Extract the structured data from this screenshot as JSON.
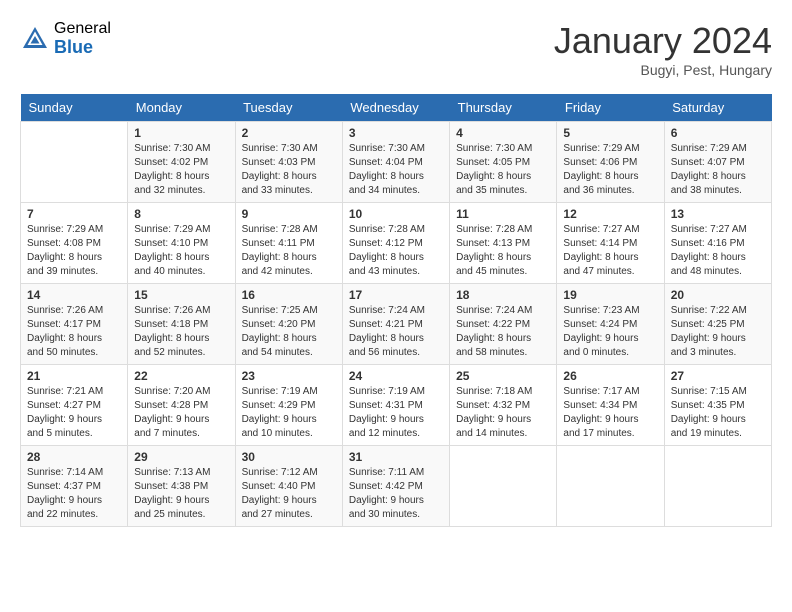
{
  "header": {
    "logo_general": "General",
    "logo_blue": "Blue",
    "month_title": "January 2024",
    "location": "Bugyi, Pest, Hungary"
  },
  "weekdays": [
    "Sunday",
    "Monday",
    "Tuesday",
    "Wednesday",
    "Thursday",
    "Friday",
    "Saturday"
  ],
  "weeks": [
    [
      {
        "day": "",
        "info": ""
      },
      {
        "day": "1",
        "info": "Sunrise: 7:30 AM\nSunset: 4:02 PM\nDaylight: 8 hours\nand 32 minutes."
      },
      {
        "day": "2",
        "info": "Sunrise: 7:30 AM\nSunset: 4:03 PM\nDaylight: 8 hours\nand 33 minutes."
      },
      {
        "day": "3",
        "info": "Sunrise: 7:30 AM\nSunset: 4:04 PM\nDaylight: 8 hours\nand 34 minutes."
      },
      {
        "day": "4",
        "info": "Sunrise: 7:30 AM\nSunset: 4:05 PM\nDaylight: 8 hours\nand 35 minutes."
      },
      {
        "day": "5",
        "info": "Sunrise: 7:29 AM\nSunset: 4:06 PM\nDaylight: 8 hours\nand 36 minutes."
      },
      {
        "day": "6",
        "info": "Sunrise: 7:29 AM\nSunset: 4:07 PM\nDaylight: 8 hours\nand 38 minutes."
      }
    ],
    [
      {
        "day": "7",
        "info": "Sunrise: 7:29 AM\nSunset: 4:08 PM\nDaylight: 8 hours\nand 39 minutes."
      },
      {
        "day": "8",
        "info": "Sunrise: 7:29 AM\nSunset: 4:10 PM\nDaylight: 8 hours\nand 40 minutes."
      },
      {
        "day": "9",
        "info": "Sunrise: 7:28 AM\nSunset: 4:11 PM\nDaylight: 8 hours\nand 42 minutes."
      },
      {
        "day": "10",
        "info": "Sunrise: 7:28 AM\nSunset: 4:12 PM\nDaylight: 8 hours\nand 43 minutes."
      },
      {
        "day": "11",
        "info": "Sunrise: 7:28 AM\nSunset: 4:13 PM\nDaylight: 8 hours\nand 45 minutes."
      },
      {
        "day": "12",
        "info": "Sunrise: 7:27 AM\nSunset: 4:14 PM\nDaylight: 8 hours\nand 47 minutes."
      },
      {
        "day": "13",
        "info": "Sunrise: 7:27 AM\nSunset: 4:16 PM\nDaylight: 8 hours\nand 48 minutes."
      }
    ],
    [
      {
        "day": "14",
        "info": "Sunrise: 7:26 AM\nSunset: 4:17 PM\nDaylight: 8 hours\nand 50 minutes."
      },
      {
        "day": "15",
        "info": "Sunrise: 7:26 AM\nSunset: 4:18 PM\nDaylight: 8 hours\nand 52 minutes."
      },
      {
        "day": "16",
        "info": "Sunrise: 7:25 AM\nSunset: 4:20 PM\nDaylight: 8 hours\nand 54 minutes."
      },
      {
        "day": "17",
        "info": "Sunrise: 7:24 AM\nSunset: 4:21 PM\nDaylight: 8 hours\nand 56 minutes."
      },
      {
        "day": "18",
        "info": "Sunrise: 7:24 AM\nSunset: 4:22 PM\nDaylight: 8 hours\nand 58 minutes."
      },
      {
        "day": "19",
        "info": "Sunrise: 7:23 AM\nSunset: 4:24 PM\nDaylight: 9 hours\nand 0 minutes."
      },
      {
        "day": "20",
        "info": "Sunrise: 7:22 AM\nSunset: 4:25 PM\nDaylight: 9 hours\nand 3 minutes."
      }
    ],
    [
      {
        "day": "21",
        "info": "Sunrise: 7:21 AM\nSunset: 4:27 PM\nDaylight: 9 hours\nand 5 minutes."
      },
      {
        "day": "22",
        "info": "Sunrise: 7:20 AM\nSunset: 4:28 PM\nDaylight: 9 hours\nand 7 minutes."
      },
      {
        "day": "23",
        "info": "Sunrise: 7:19 AM\nSunset: 4:29 PM\nDaylight: 9 hours\nand 10 minutes."
      },
      {
        "day": "24",
        "info": "Sunrise: 7:19 AM\nSunset: 4:31 PM\nDaylight: 9 hours\nand 12 minutes."
      },
      {
        "day": "25",
        "info": "Sunrise: 7:18 AM\nSunset: 4:32 PM\nDaylight: 9 hours\nand 14 minutes."
      },
      {
        "day": "26",
        "info": "Sunrise: 7:17 AM\nSunset: 4:34 PM\nDaylight: 9 hours\nand 17 minutes."
      },
      {
        "day": "27",
        "info": "Sunrise: 7:15 AM\nSunset: 4:35 PM\nDaylight: 9 hours\nand 19 minutes."
      }
    ],
    [
      {
        "day": "28",
        "info": "Sunrise: 7:14 AM\nSunset: 4:37 PM\nDaylight: 9 hours\nand 22 minutes."
      },
      {
        "day": "29",
        "info": "Sunrise: 7:13 AM\nSunset: 4:38 PM\nDaylight: 9 hours\nand 25 minutes."
      },
      {
        "day": "30",
        "info": "Sunrise: 7:12 AM\nSunset: 4:40 PM\nDaylight: 9 hours\nand 27 minutes."
      },
      {
        "day": "31",
        "info": "Sunrise: 7:11 AM\nSunset: 4:42 PM\nDaylight: 9 hours\nand 30 minutes."
      },
      {
        "day": "",
        "info": ""
      },
      {
        "day": "",
        "info": ""
      },
      {
        "day": "",
        "info": ""
      }
    ]
  ]
}
